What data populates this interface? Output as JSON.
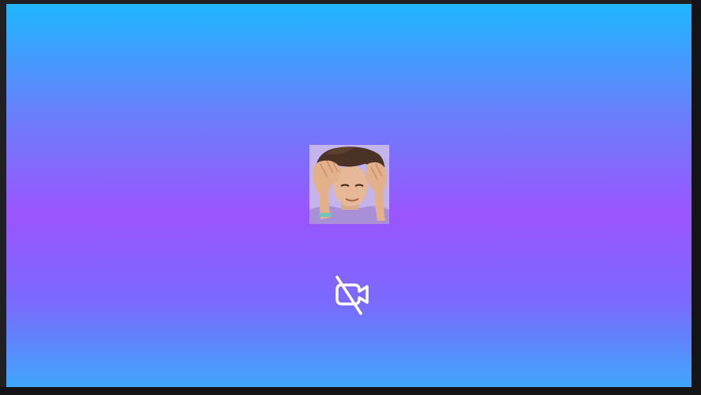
{
  "participant": {
    "avatar_icon": "avatar-photo-hands-on-head",
    "camera_icon": "video-camera-off-icon",
    "camera_state": "off"
  },
  "colors": {
    "gradient_top": "#1fb6fe",
    "gradient_mid": "#9a55fd",
    "gradient_bottom": "#3fa6fb",
    "icon": "#ffffff",
    "frame": "#202022"
  }
}
